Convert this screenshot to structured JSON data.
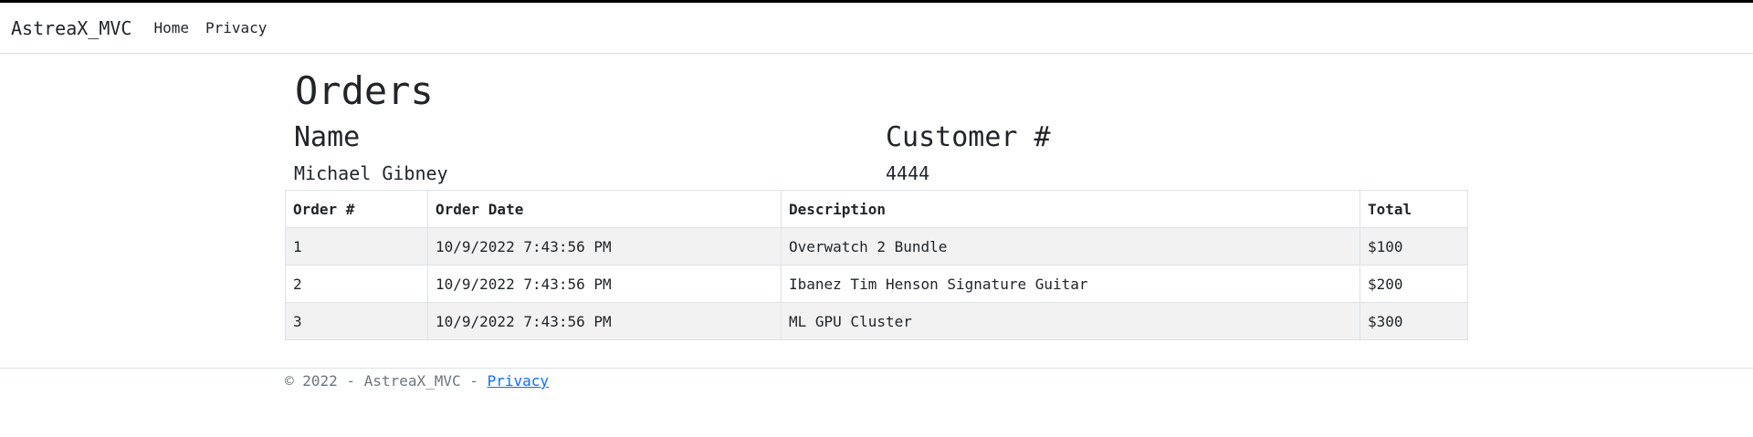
{
  "navbar": {
    "brand": "AstreaX_MVC",
    "links": [
      {
        "label": "Home"
      },
      {
        "label": "Privacy"
      }
    ]
  },
  "main": {
    "title": "Orders",
    "customer": {
      "name_label": "Name",
      "name_value": "Michael Gibney",
      "number_label": "Customer #",
      "number_value": "4444"
    },
    "table": {
      "headers": [
        "Order #",
        "Order Date",
        "Description",
        "Total"
      ],
      "rows": [
        [
          "1",
          "10/9/2022 7:43:56 PM",
          "Overwatch 2 Bundle",
          "$100"
        ],
        [
          "2",
          "10/9/2022 7:43:56 PM",
          "Ibanez Tim Henson Signature Guitar",
          "$200"
        ],
        [
          "3",
          "10/9/2022 7:43:56 PM",
          "ML GPU Cluster",
          "$300"
        ]
      ]
    }
  },
  "footer": {
    "text": "© 2022 - AstreaX_MVC - ",
    "privacy_link": "Privacy"
  }
}
